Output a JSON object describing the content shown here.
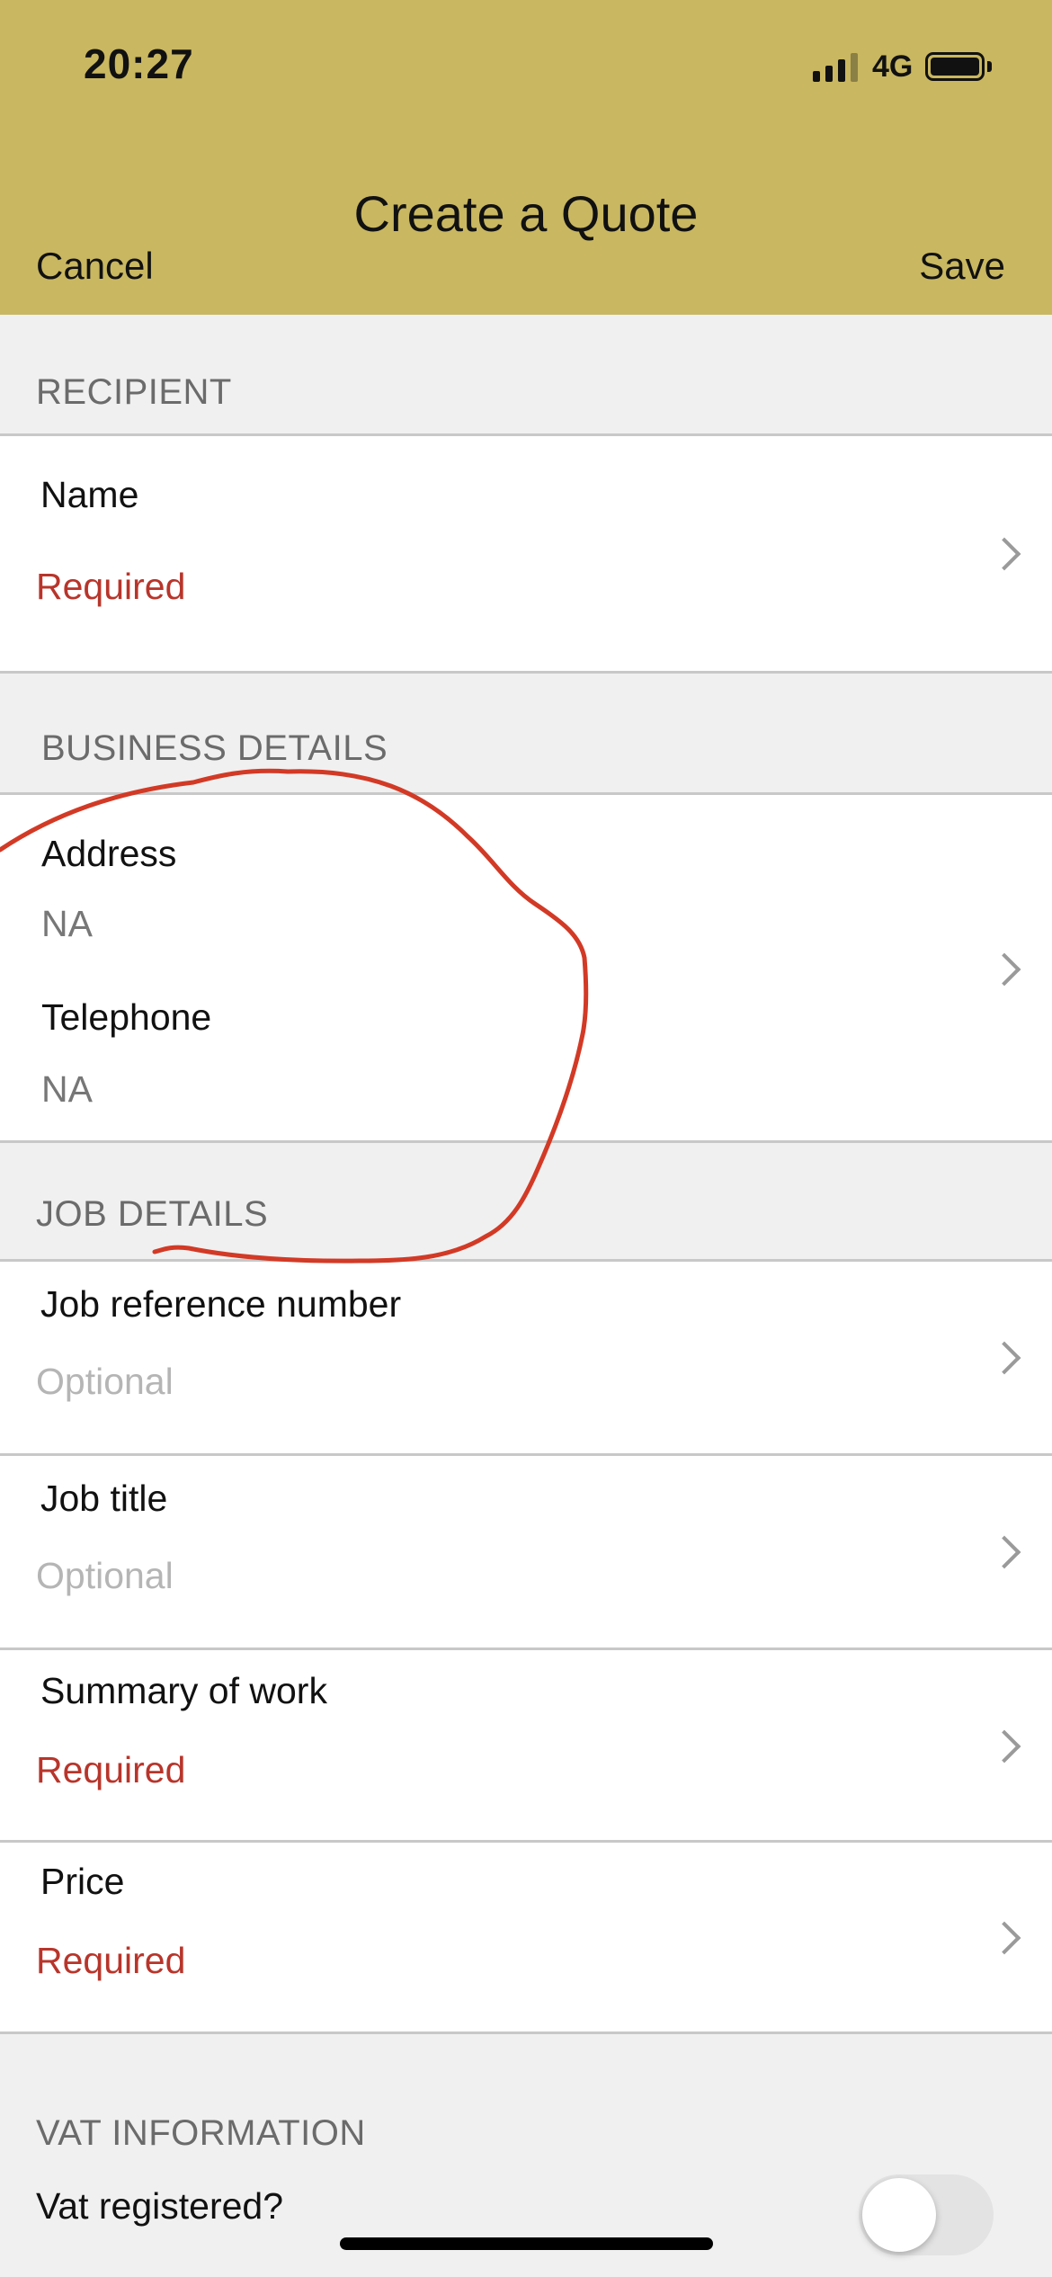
{
  "status_bar": {
    "time": "20:27",
    "network": "4G"
  },
  "header": {
    "title": "Create a Quote",
    "cancel_label": "Cancel",
    "save_label": "Save",
    "background_color": "#c9b761"
  },
  "recipient": {
    "section_title": "RECIPIENT",
    "name_label": "Name",
    "name_value": "Required"
  },
  "business_details": {
    "section_title": "BUSINESS DETAILS",
    "address_label": "Address",
    "address_value": "NA",
    "telephone_label": "Telephone",
    "telephone_value": "NA"
  },
  "job_details": {
    "section_title": "JOB DETAILS",
    "items": [
      {
        "label": "Job reference number",
        "value": "Optional"
      },
      {
        "label": "Job title",
        "value": "Optional"
      },
      {
        "label": "Summary of work",
        "value": "Required"
      },
      {
        "label": "Price",
        "value": "Required"
      }
    ]
  },
  "vat_information": {
    "section_title": "VAT INFORMATION",
    "vat_registered_label": "Vat registered?",
    "vat_registered_on": false
  },
  "colors": {
    "required": "#b8352b",
    "optional": "#b5b5b5",
    "annotation": "#d23a26"
  }
}
